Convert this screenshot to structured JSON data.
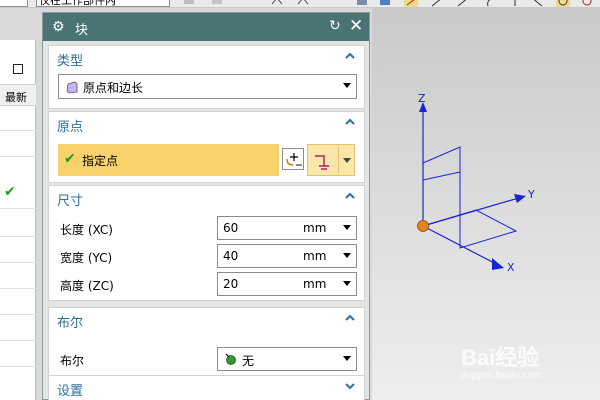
{
  "toolbar": {
    "filter_value": "仅在工作部件内"
  },
  "left_panel": {
    "header": "最新"
  },
  "dialog": {
    "title": "块",
    "sections": {
      "type": {
        "label": "类型",
        "selected": "原点和边长"
      },
      "origin": {
        "label": "原点",
        "point_label": "指定点"
      },
      "dimensions": {
        "label": "尺寸",
        "rows": [
          {
            "label": "长度 (XC)",
            "value": "60",
            "unit": "mm"
          },
          {
            "label": "宽度 (YC)",
            "value": "40",
            "unit": "mm"
          },
          {
            "label": "高度 (ZC)",
            "value": "20",
            "unit": "mm"
          }
        ]
      },
      "boolean": {
        "label": "布尔",
        "row_label": "布尔",
        "selected": "无"
      },
      "settings": {
        "label": "设置"
      }
    }
  },
  "viewport": {
    "axis_x": "X",
    "axis_y": "Y",
    "axis_z": "Z"
  },
  "watermark": {
    "brand": "Bai经验",
    "url": "jingyan.baidu.com"
  },
  "colors": {
    "titlebar": "#4a7474",
    "section_label": "#2d6f9d",
    "highlight": "#f7d16a",
    "wcs_blue": "#1a23d6",
    "origin_orange": "#e8821c"
  }
}
